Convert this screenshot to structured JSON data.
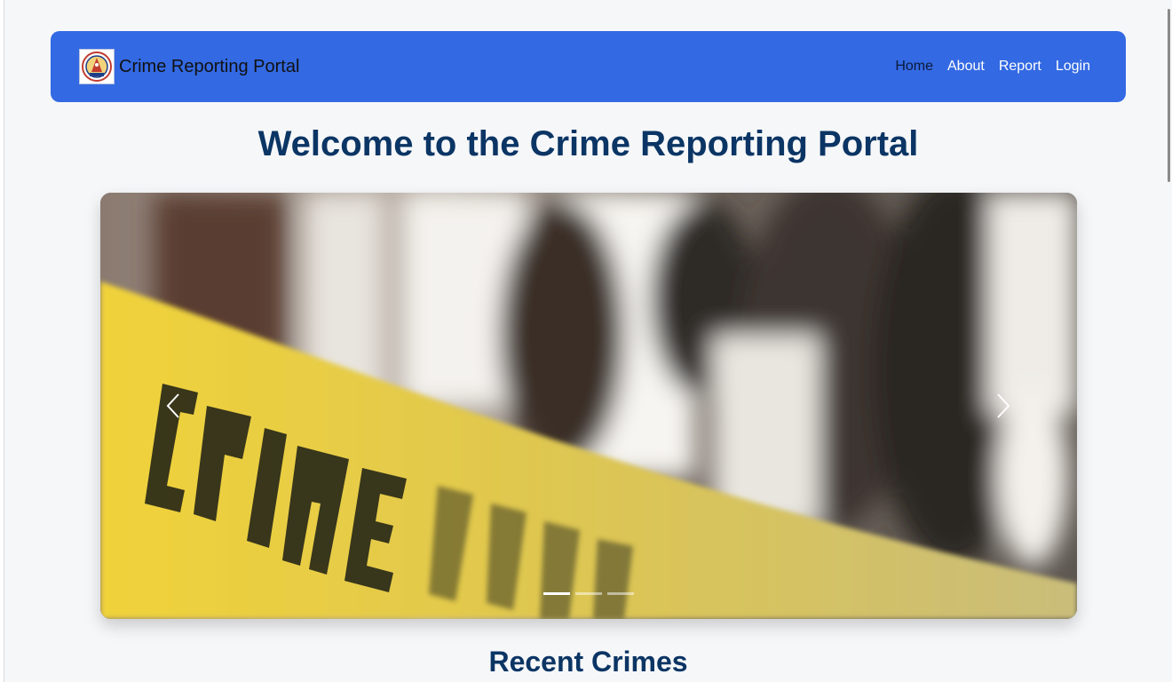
{
  "navbar": {
    "brand": "Crime Reporting Portal",
    "logo_icon": "police-emblem-icon",
    "links": [
      "Home",
      "About",
      "Report",
      "Login"
    ],
    "background_color": "#3369e3"
  },
  "hero": {
    "title": "Welcome to the Crime Reporting Portal"
  },
  "carousel": {
    "image_description_icon": "crime-scene-tape-image",
    "tape_text": "CRIME SCENE DO NOT CROSS",
    "slide_count": 3,
    "active_slide": 1,
    "prev_icon": "chevron-left-icon",
    "next_icon": "chevron-right-icon"
  },
  "sections": {
    "recent_crimes_title": "Recent Crimes"
  }
}
